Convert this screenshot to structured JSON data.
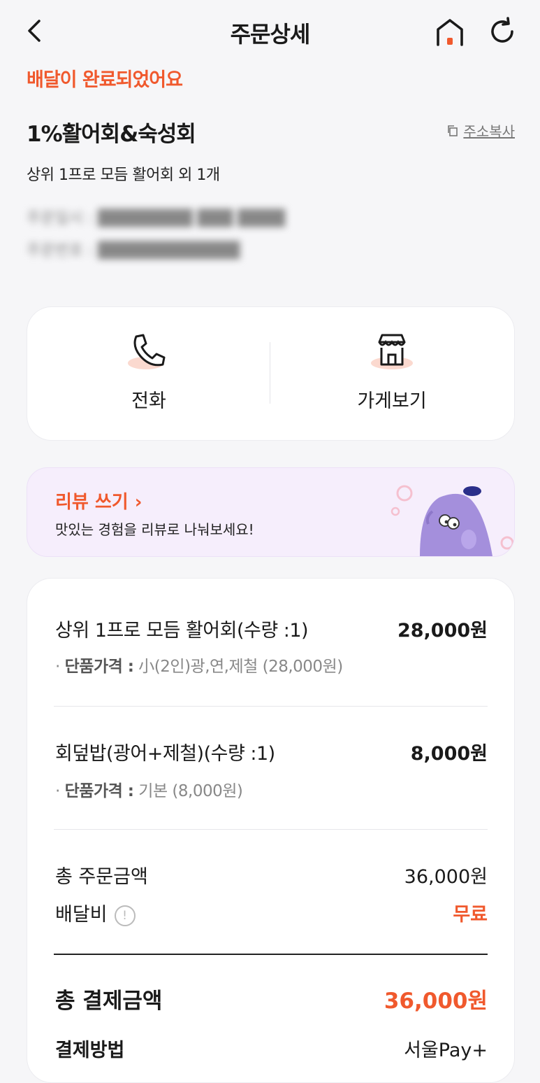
{
  "header": {
    "title": "주문상세"
  },
  "status": "배달이 완료되었어요",
  "store": {
    "name": "1%활어회&숙성회",
    "copy_label": "주소복사"
  },
  "menu_summary": "상위 1프로 모듬 활어회 외 1개",
  "actions": {
    "call_label": "전화",
    "store_label": "가게보기"
  },
  "review": {
    "title": "리뷰 쓰기",
    "subtitle": "맛있는 경험을 리뷰로 나눠보세요!"
  },
  "items": [
    {
      "name": "상위 1프로 모듬 활어회(수량 :1)",
      "price": "28,000원",
      "opt_label": "단품가격 :",
      "opt_value": "小(2인)광,연,제철 (28,000원)"
    },
    {
      "name": "회덮밥(광어+제철)(수량 :1)",
      "price": "8,000원",
      "opt_label": "단품가격 :",
      "opt_value": "기본 (8,000원)"
    }
  ],
  "totals": {
    "order_label": "총 주문금액",
    "order_value": "36,000원",
    "delivery_label": "배달비",
    "delivery_value": "무료",
    "pay_label": "총 결제금액",
    "pay_value": "36,000원",
    "method_label": "결제방법",
    "method_value": "서울Pay+"
  },
  "colors": {
    "accent": "#f0592d",
    "mascot": "#a48fdc",
    "review_bg": "#f6eefc"
  }
}
